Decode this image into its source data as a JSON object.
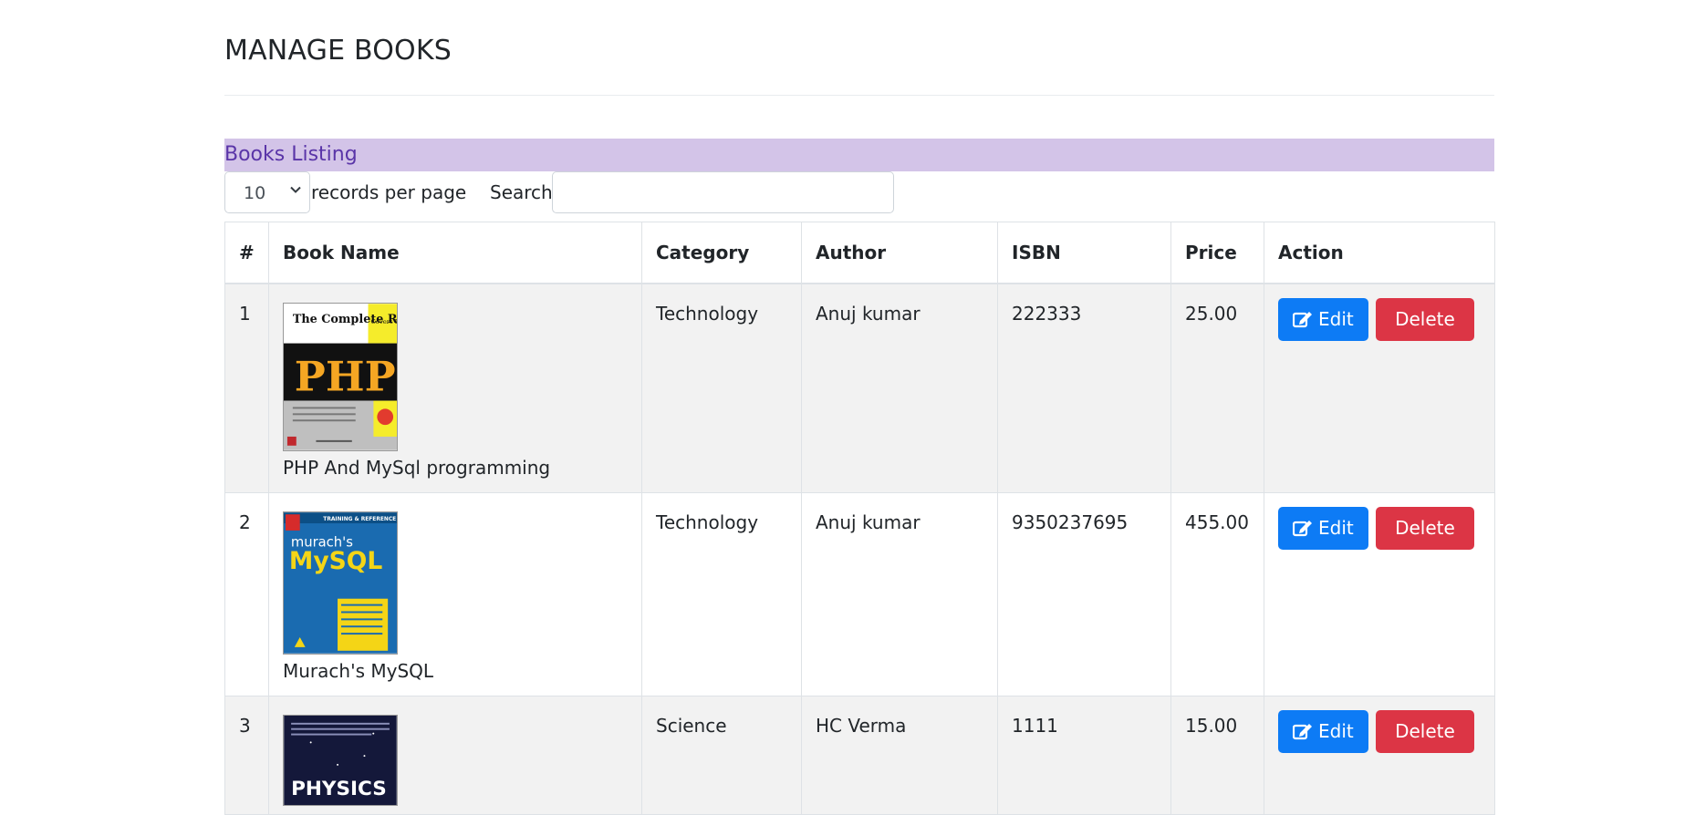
{
  "page": {
    "title": "MANAGE BOOKS"
  },
  "panel": {
    "heading": "Books Listing"
  },
  "controls": {
    "per_page_value": "10",
    "per_page_label": "records per page",
    "search_label": "Search:",
    "search_value": ""
  },
  "table": {
    "headers": [
      "#",
      "Book Name",
      "Category",
      "Author",
      "ISBN",
      "Price",
      "Action"
    ],
    "rows": [
      {
        "num": "1",
        "name": "PHP And MySql programming",
        "category": "Technology",
        "author": "Anuj kumar",
        "isbn": "222333",
        "price": "25.00",
        "cover": {
          "top": "The Complete Reference",
          "badge": "Covers PHP 5.2",
          "big": "PHP"
        }
      },
      {
        "num": "2",
        "name": "Murach's MySQL",
        "category": "Technology",
        "author": "Anuj kumar",
        "isbn": "9350237695",
        "price": "455.00",
        "cover": {
          "top": "TRAINING & REFERENCE",
          "small": "murach's",
          "big": "MySQL"
        }
      },
      {
        "num": "3",
        "name": "",
        "category": "Science",
        "author": "HC Verma",
        "isbn": "1111",
        "price": "15.00",
        "cover": {
          "big": "PHYSICS"
        }
      }
    ],
    "edit_label": "Edit",
    "delete_label": "Delete"
  },
  "icons": {
    "edit": "edit-icon",
    "chevron": "chevron-down-icon"
  },
  "colors": {
    "panel_bg": "#d3c4e8",
    "panel_text": "#5a35a8",
    "edit_btn": "#0d7bf5",
    "delete_btn": "#dc3545",
    "stripe": "#f2f2f2"
  }
}
